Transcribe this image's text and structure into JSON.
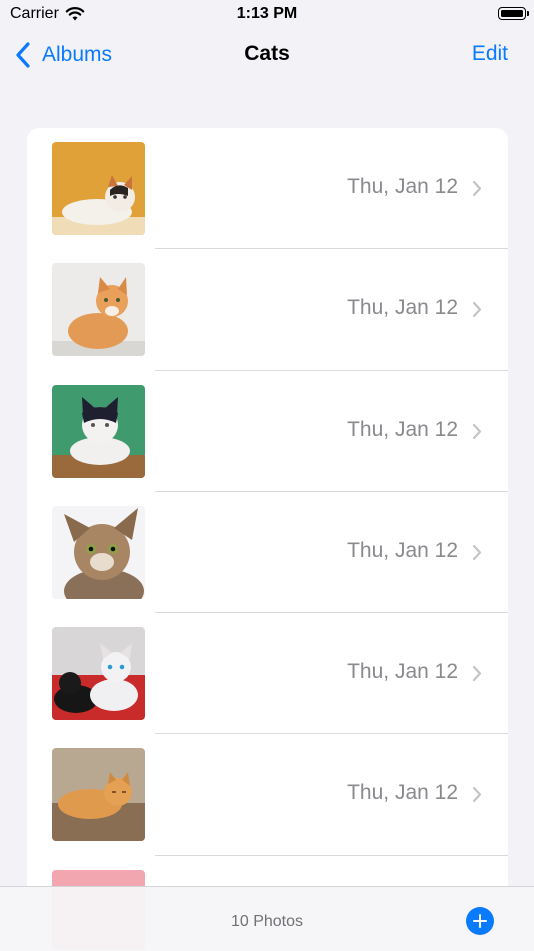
{
  "status_bar": {
    "carrier": "Carrier",
    "time": "1:13 PM"
  },
  "nav": {
    "back_label": "Albums",
    "title": "Cats",
    "edit_label": "Edit"
  },
  "photos": [
    {
      "date": "Thu, Jan 12",
      "thumb": "cat-orange-background"
    },
    {
      "date": "Thu, Jan 12",
      "thumb": "cat-ginger-sitting"
    },
    {
      "date": "Thu, Jan 12",
      "thumb": "cat-green-background"
    },
    {
      "date": "Thu, Jan 12",
      "thumb": "cat-tabby-closeup"
    },
    {
      "date": "Thu, Jan 12",
      "thumb": "cats-kittens-red-blanket"
    },
    {
      "date": "Thu, Jan 12",
      "thumb": "cat-ginger-lying"
    },
    {
      "date": "",
      "thumb": "cat-pink-background"
    }
  ],
  "toolbar": {
    "count_label": "10 Photos"
  },
  "colors": {
    "accent": "#0a7aff",
    "background": "#f2f2f7",
    "secondary_text": "#8a8a8e"
  }
}
